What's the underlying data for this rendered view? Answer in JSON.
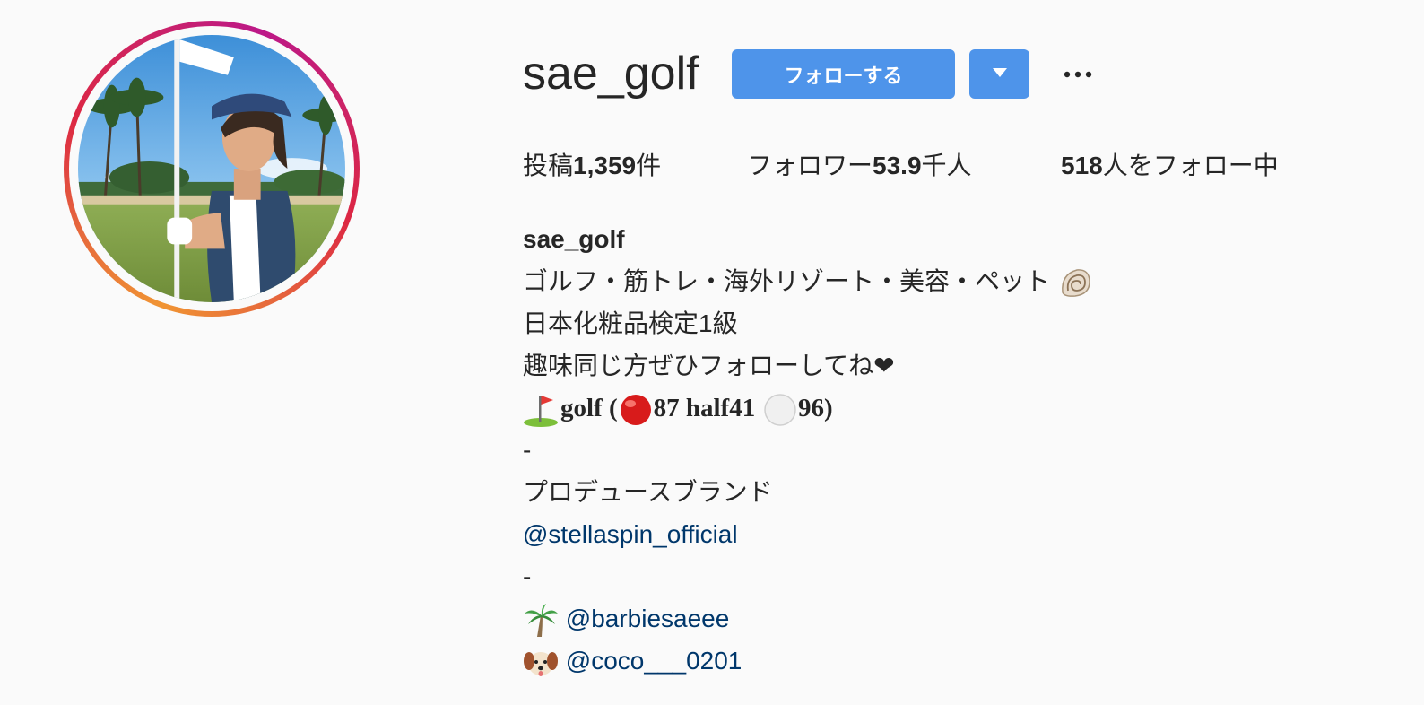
{
  "profile": {
    "username": "sae_golf",
    "follow_label": "フォローする",
    "more_label": "…"
  },
  "stats": {
    "posts_prefix": "投稿",
    "posts_count": "1,359",
    "posts_suffix": "件",
    "followers_prefix": "フォロワー",
    "followers_count": "53.9",
    "followers_suffix": "千人",
    "following_count": "518",
    "following_suffix": "人をフォロー中"
  },
  "bio": {
    "name": "sae_golf",
    "line1": "ゴルフ・筋トレ・海外リゾート・美容・ペット",
    "line2": "日本化粧品検定1級",
    "line3": "趣味同じ方ぜひフォローしてね❤",
    "golf_word": "golf (",
    "golf_score1": "87 half41",
    "golf_score2": "96)",
    "divider1": "-",
    "line_brand": "プロデュースブランド",
    "brand_link": "@stellaspin_official",
    "divider2": "-",
    "link1": "@barbiesaeee",
    "link2": "@coco___0201"
  },
  "icons": {
    "shell": "spiral-shell-icon",
    "flag": "golf-flag-icon",
    "red_ball": "red-circle-icon",
    "white_ball": "white-circle-icon",
    "palm": "palm-tree-icon",
    "dog": "dog-face-icon",
    "dropdown": "chevron-down-icon",
    "more": "more-dots-icon"
  },
  "colors": {
    "accent": "#4e94ea",
    "link": "#00376b",
    "text": "#262626",
    "background": "#fafafa"
  }
}
